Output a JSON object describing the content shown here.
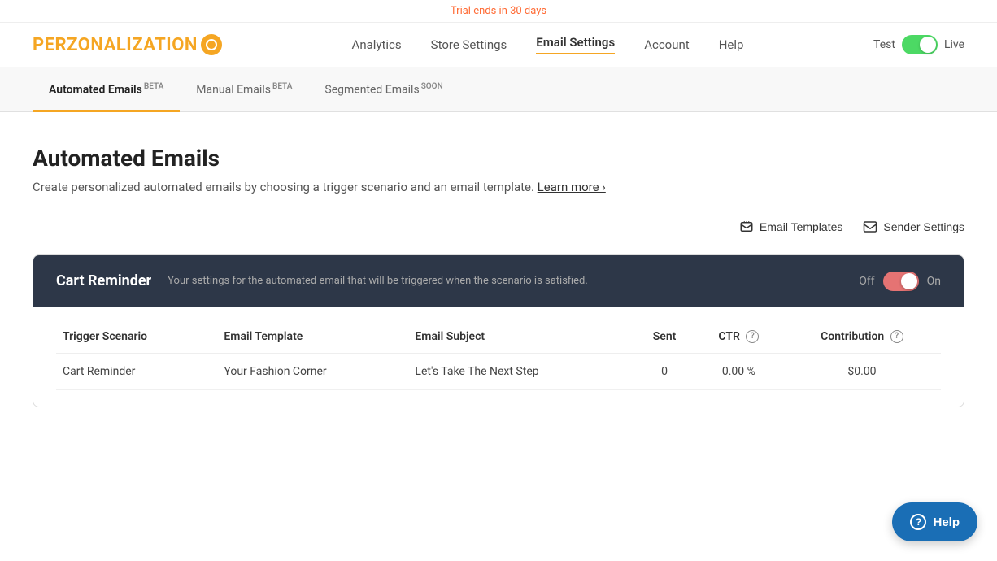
{
  "trial_bar": {
    "text": "Trial ends in 30 days"
  },
  "header": {
    "logo_text": "PERZONALIZATION",
    "toggle": {
      "test_label": "Test",
      "live_label": "Live"
    },
    "nav": [
      {
        "label": "Analytics",
        "active": false
      },
      {
        "label": "Store Settings",
        "active": false
      },
      {
        "label": "Email Settings",
        "active": true
      },
      {
        "label": "Account",
        "active": false
      },
      {
        "label": "Help",
        "active": false
      }
    ]
  },
  "tabs": [
    {
      "label": "Automated Emails",
      "badge": "BETA",
      "active": true
    },
    {
      "label": "Manual Emails",
      "badge": "BETA",
      "active": false
    },
    {
      "label": "Segmented Emails",
      "badge": "SOON",
      "active": false
    }
  ],
  "page": {
    "title": "Automated Emails",
    "description": "Create personalized automated emails by choosing a trigger scenario and an email template.",
    "learn_more": "Learn more"
  },
  "actions": [
    {
      "label": "Email Templates",
      "icon": "email-template-icon"
    },
    {
      "label": "Sender Settings",
      "icon": "sender-settings-icon"
    }
  ],
  "cart_reminder": {
    "title": "Cart Reminder",
    "description": "Your settings for the automated email that will be triggered when the scenario is satisfied.",
    "toggle_off": "Off",
    "toggle_on": "On",
    "table": {
      "headers": [
        {
          "label": "Trigger Scenario",
          "has_help": false
        },
        {
          "label": "Email Template",
          "has_help": false
        },
        {
          "label": "Email Subject",
          "has_help": false
        },
        {
          "label": "Sent",
          "has_help": false
        },
        {
          "label": "CTR",
          "has_help": true
        },
        {
          "label": "Contribution",
          "has_help": true
        }
      ],
      "rows": [
        {
          "trigger_scenario": "Cart Reminder",
          "email_template": "Your Fashion Corner",
          "email_subject": "Let's Take The Next Step",
          "sent": "0",
          "ctr": "0.00 %",
          "contribution": "$0.00"
        }
      ]
    }
  },
  "help_button": {
    "label": "Help"
  }
}
